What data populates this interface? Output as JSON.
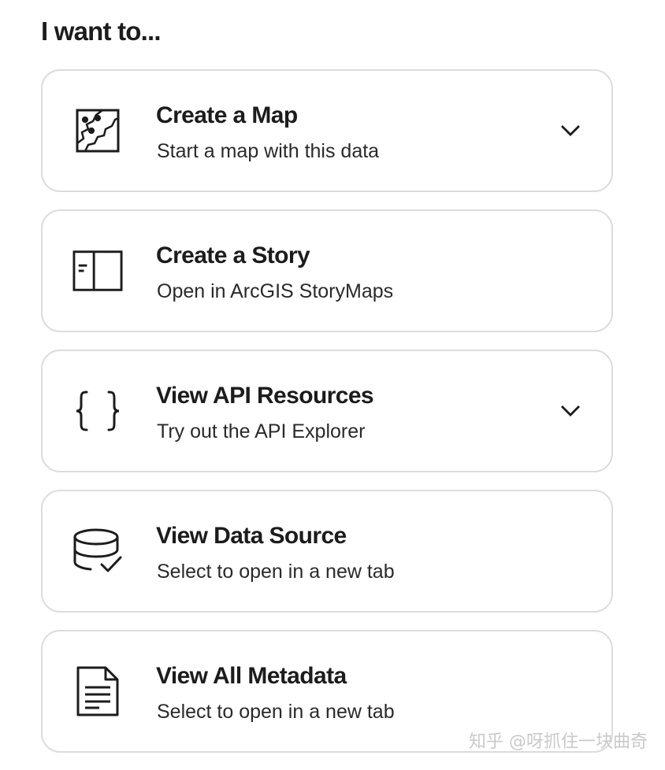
{
  "heading": "I want to...",
  "cards": [
    {
      "title": "Create a Map",
      "subtitle": "Start a map with this data",
      "icon": "map-icon",
      "expandable": true
    },
    {
      "title": "Create a Story",
      "subtitle": "Open in ArcGIS StoryMaps",
      "icon": "storymap-icon",
      "expandable": false
    },
    {
      "title": "View API Resources",
      "subtitle": "Try out the API Explorer",
      "icon": "code-braces-icon",
      "expandable": true
    },
    {
      "title": "View Data Source",
      "subtitle": "Select to open in a new tab",
      "icon": "database-check-icon",
      "expandable": false
    },
    {
      "title": "View All Metadata",
      "subtitle": "Select to open in a new tab",
      "icon": "document-icon",
      "expandable": false
    }
  ],
  "watermark": "知乎 @呀抓住一块曲奇",
  "colors": {
    "text": "#1c1c1c",
    "border": "#dcdcdc",
    "background": "#ffffff",
    "watermark": "#c9c9c9"
  }
}
